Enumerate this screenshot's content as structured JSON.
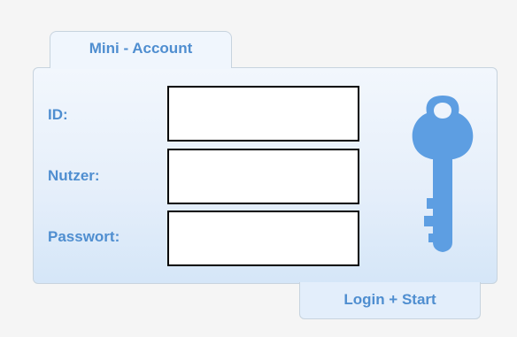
{
  "tab": {
    "title": "Mini - Account"
  },
  "form": {
    "id_label": "ID:",
    "id_value": "",
    "user_label": "Nutzer:",
    "user_value": "",
    "password_label": "Passwort:",
    "password_value": ""
  },
  "action": {
    "login_label": "Login + Start"
  },
  "icons": {
    "key": "key-icon"
  },
  "colors": {
    "accent": "#4f8ed0",
    "panel_border": "#c7d3de",
    "panel_top": "#f2f7fd",
    "panel_bottom": "#d5e6f8",
    "background": "#f5f5f5"
  }
}
